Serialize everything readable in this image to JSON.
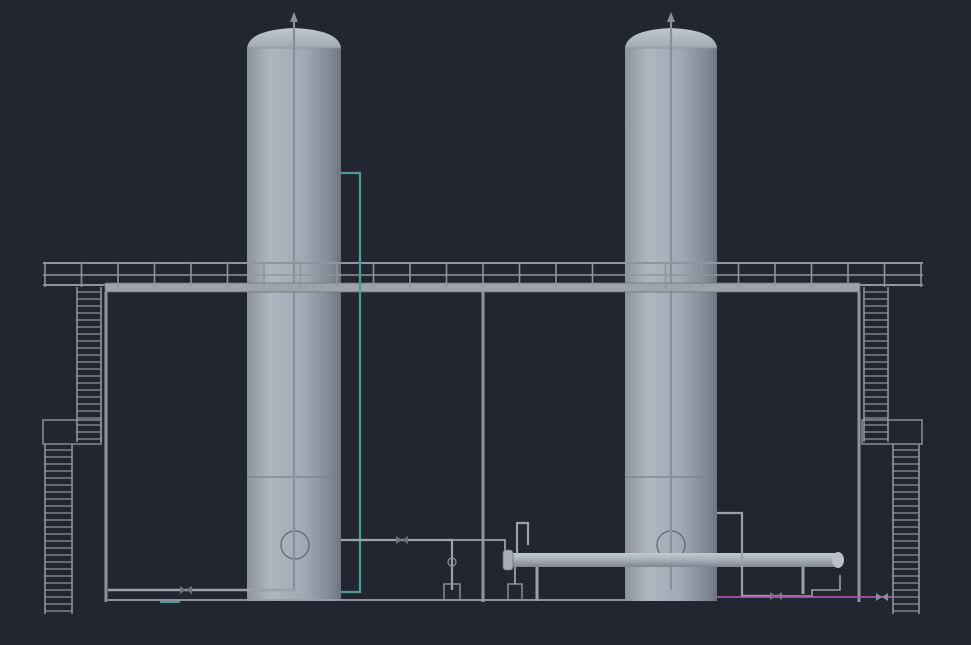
{
  "viewport": {
    "background": "#212630"
  },
  "colors": {
    "vessel_body": "#a3acb7",
    "vessel_shade": "#7c858f",
    "vessel_highlight": "#c5ccd4",
    "steel": "#8f959b",
    "steel_dark": "#6d7278",
    "pipe_grey": "#9aa1a8",
    "pipe_teal": "#4f9c97",
    "pipe_magenta": "#b14fb5"
  },
  "equipment": {
    "left_column": "vertical-column-left",
    "right_column": "vertical-column-right",
    "exchanger": "horizontal-heat-exchanger",
    "platform": "elevated-pipe-rack-platform",
    "stairs": [
      "upper-left-stair",
      "lower-left-stair",
      "upper-right-stair",
      "lower-right-stair"
    ]
  }
}
